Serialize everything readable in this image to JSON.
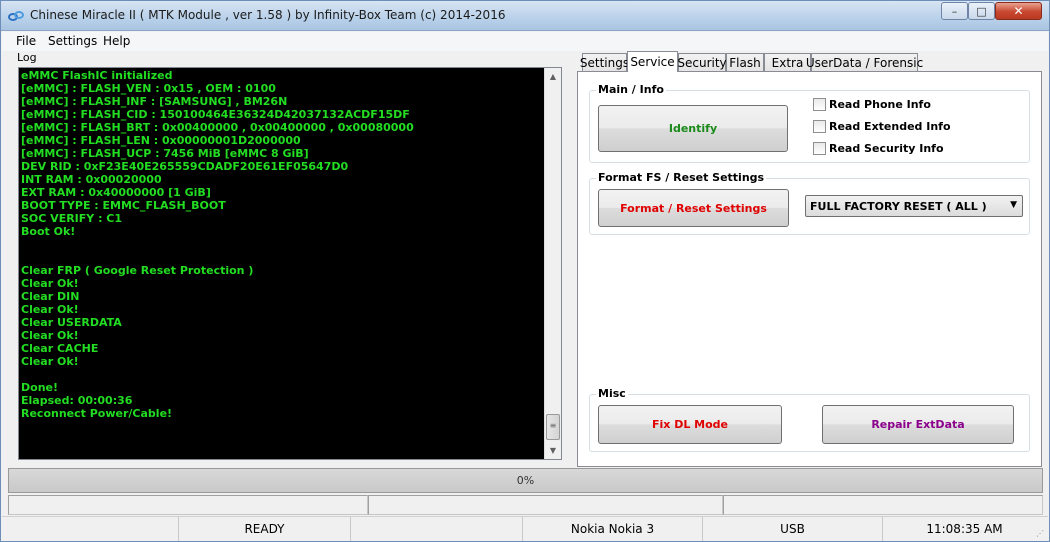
{
  "window": {
    "title": "Chinese Miracle II ( MTK Module , ver 1.58 ) by Infinity-Box Team (c) 2014-2016",
    "icon": "chain-link-icon",
    "controls": {
      "minimize": "–",
      "maximize": "□",
      "close": "✕"
    }
  },
  "menu": {
    "items": [
      "File",
      "Settings",
      "Help"
    ]
  },
  "log": {
    "label": "Log",
    "lines": [
      "eMMC FlashIC initialized",
      "[eMMC] : FLASH_VEN : 0x15 , OEM : 0100",
      "[eMMC] : FLASH_INF : [SAMSUNG] , BM26N",
      "[eMMC] : FLASH_CID : 150100464E36324D42037132ACDF15DF",
      "[eMMC] : FLASH_BRT : 0x00400000 , 0x00400000 , 0x00080000",
      "[eMMC] : FLASH_LEN : 0x00000001D2000000",
      "[eMMC] : FLASH_UCP : 7456 MiB [eMMC 8 GiB]",
      "DEV RID    : 0xF23E40E265559CDADF20E61EF05647D0",
      "INT RAM    : 0x00020000",
      "EXT RAM    : 0x40000000 [1 GiB]",
      "BOOT TYPE  : EMMC_FLASH_BOOT",
      "SOC VERIFY : C1",
      "Boot Ok!",
      "",
      "",
      "Clear FRP ( Google Reset Protection )",
      "Clear Ok!",
      "Clear DIN",
      "Clear Ok!",
      "Clear USERDATA",
      "Clear Ok!",
      "Clear CACHE",
      "Clear Ok!",
      "",
      "Done!",
      "Elapsed: 00:00:36",
      "Reconnect Power/Cable!"
    ],
    "scroll_up": "▲",
    "scroll_down": "▼",
    "scroll_thumb_grip": "≡"
  },
  "tabs": {
    "items": [
      "Settings",
      "Service",
      "Security",
      "Flash",
      "Extra",
      "UserData / Forensic"
    ],
    "active": "Service"
  },
  "service": {
    "main_info": {
      "title": "Main / Info",
      "identify_label": "Identify",
      "checkboxes": [
        "Read Phone Info",
        "Read Extended Info",
        "Read Security Info"
      ]
    },
    "format_fs": {
      "title": "Format FS / Reset Settings",
      "button_label": "Format / Reset Settings",
      "selected_option": "FULL FACTORY RESET ( ALL )",
      "dropdown_arrow": "▼"
    },
    "misc": {
      "title": "Misc",
      "fix_dl_label": "Fix DL Mode",
      "repair_label": "Repair ExtData"
    }
  },
  "progress": {
    "label": "0%",
    "value": 0
  },
  "status": {
    "state": "READY",
    "device": "Nokia Nokia 3",
    "connection": "USB",
    "time": "11:08:35 AM"
  },
  "colors": {
    "log_text": "#22dd22",
    "identify": "#1a8a1a",
    "format": "#e00000",
    "fix_dl": "#e00000",
    "repair": "#8b008b"
  }
}
